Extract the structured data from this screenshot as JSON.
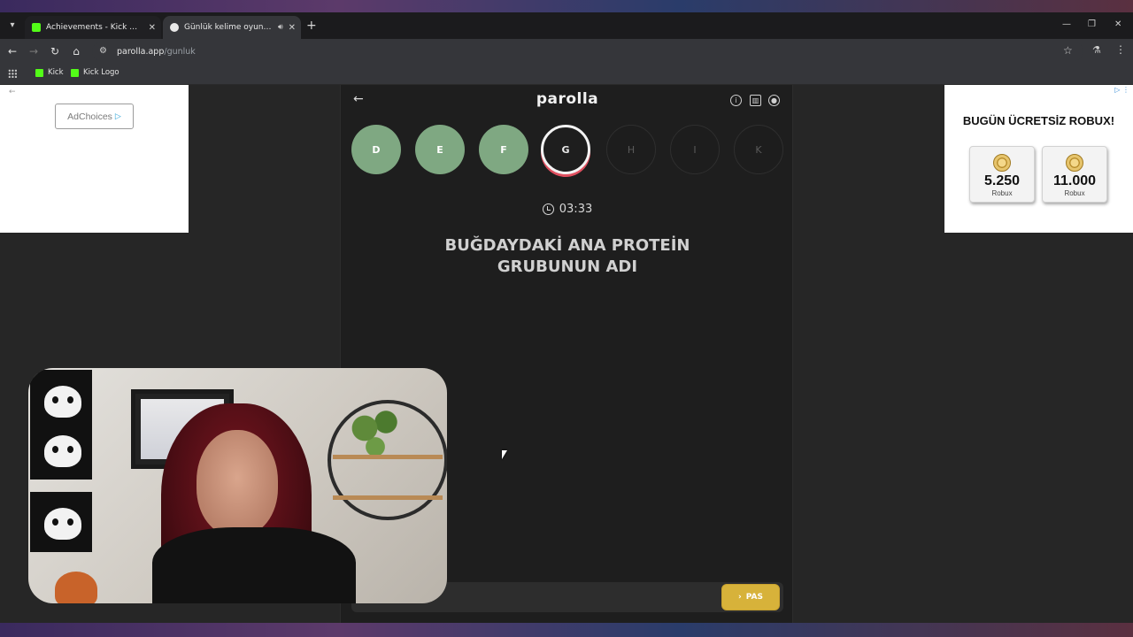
{
  "browser": {
    "tabs": [
      {
        "title": "Achievements - Kick Dashboard",
        "favicon": "kick-icon"
      },
      {
        "title": "Günlük kelime oyunu - par",
        "favicon": "parolla-icon"
      }
    ],
    "url_host": "parolla.app",
    "url_path": "/gunluk",
    "bookmarks": [
      {
        "label": "Kick"
      },
      {
        "label": "Kick Logo"
      }
    ],
    "accent_color": "#53fc18"
  },
  "ads": {
    "left": {
      "adchoices_label": "AdChoices"
    },
    "right": {
      "headline": "BUGÜN ÜCRETSİZ ROBUX!",
      "cards": [
        {
          "amount": "5.250",
          "unit": "Robux"
        },
        {
          "amount": "11.000",
          "unit": "Robux"
        }
      ]
    }
  },
  "game": {
    "logo": "parolla",
    "letters": [
      {
        "letter": "D",
        "state": "done"
      },
      {
        "letter": "E",
        "state": "done"
      },
      {
        "letter": "F",
        "state": "done"
      },
      {
        "letter": "G",
        "state": "current"
      },
      {
        "letter": "H",
        "state": "pending"
      },
      {
        "letter": "I",
        "state": "pending"
      },
      {
        "letter": "K",
        "state": "pending"
      }
    ],
    "timer": "03:33",
    "question_line1": "BUĞDAYDAKİ ANA PROTEİN",
    "question_line2": "GRUBUNUN ADI",
    "pass_label": "PAS",
    "colors": {
      "done": "#7fa882",
      "current_ring": "#e05060",
      "pass": "#d7b23a"
    }
  },
  "webcam": {
    "caption": "webcam-feed"
  }
}
